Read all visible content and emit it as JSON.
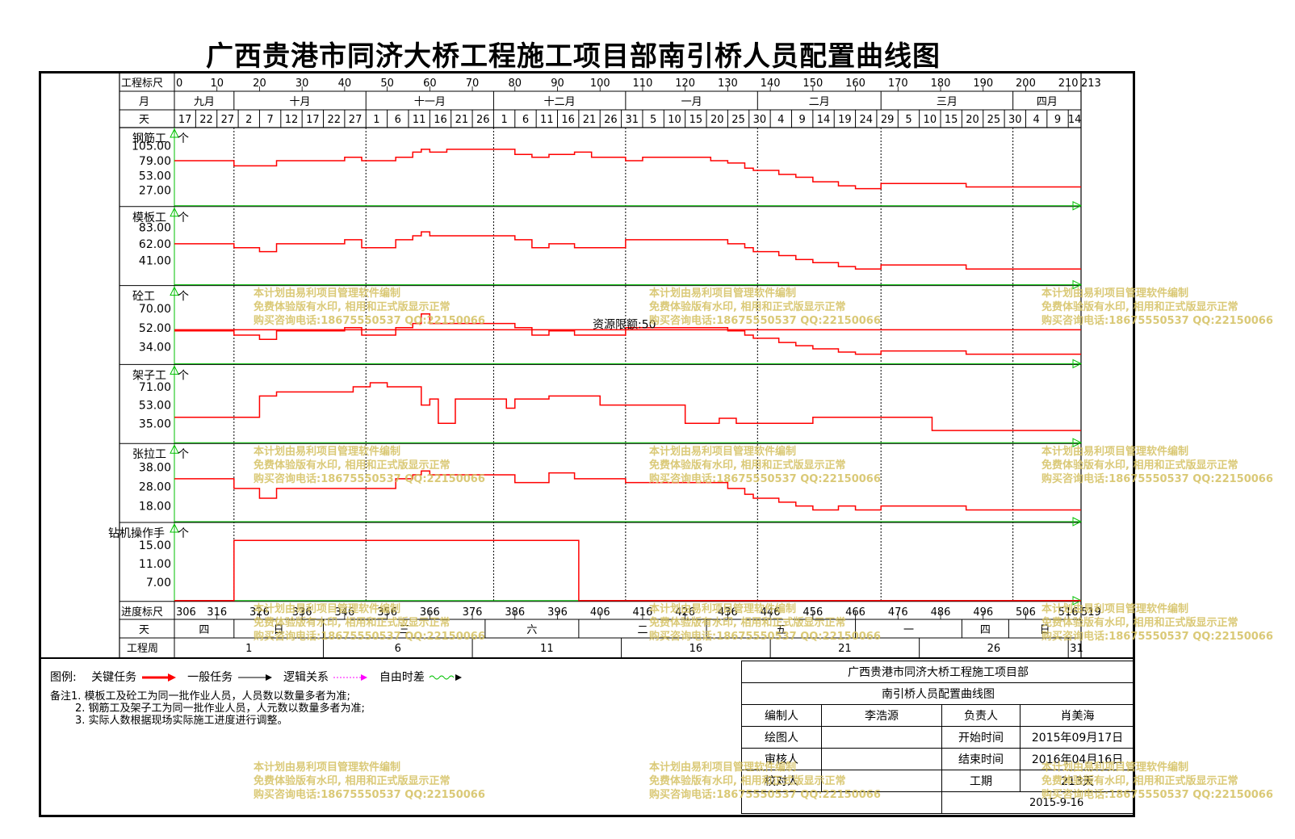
{
  "title": "广西贵港市同济大桥工程施工项目部南引桥人员配置曲线图",
  "header": {
    "row1_label": "工程标尺",
    "row2_label": "月",
    "row3_label": "天",
    "scale_ticks": [
      "0",
      "10",
      "20",
      "30",
      "40",
      "50",
      "60",
      "70",
      "80",
      "90",
      "100",
      "110",
      "120",
      "130",
      "140",
      "150",
      "160",
      "170",
      "180",
      "190",
      "200",
      "210",
      "213"
    ],
    "months": [
      "九月",
      "十月",
      "十一月",
      "十二月",
      "一月",
      "二月",
      "三月",
      "四月"
    ],
    "days": [
      "17",
      "22",
      "27",
      "2",
      "7",
      "12",
      "17",
      "22",
      "27",
      "1",
      "6",
      "11",
      "16",
      "21",
      "26",
      "1",
      "6",
      "11",
      "16",
      "21",
      "26",
      "31",
      "5",
      "10",
      "15",
      "20",
      "25",
      "30",
      "4",
      "9",
      "14",
      "19",
      "24",
      "29",
      "5",
      "10",
      "15",
      "20",
      "25",
      "30",
      "4",
      "9",
      "14"
    ]
  },
  "footer": {
    "row1_label": "进度标尺",
    "row2_label": "天",
    "row3_label": "工程周",
    "progress_ticks": [
      "306",
      "316",
      "326",
      "336",
      "346",
      "356",
      "366",
      "376",
      "386",
      "396",
      "406",
      "416",
      "426",
      "436",
      "446",
      "456",
      "466",
      "476",
      "486",
      "496",
      "506",
      "516",
      "519"
    ],
    "weekdays": [
      "四",
      "日",
      "三",
      "六",
      "二",
      "五",
      "一",
      "四",
      "日"
    ],
    "weeks": [
      "1",
      "6",
      "11",
      "16",
      "21",
      "26",
      "31"
    ]
  },
  "unit_label": "个",
  "quota_label": "资源限额:50",
  "chart_data": {
    "type": "line",
    "step": true,
    "x_unit": "day",
    "x_range": [
      0,
      213
    ],
    "panels": [
      {
        "name": "钢筋工",
        "yticks": [
          "105.00",
          "79.00",
          "53.00",
          "27.00"
        ],
        "ylim": [
          0,
          130
        ],
        "x": [
          0,
          10,
          14,
          20,
          24,
          40,
          44,
          52,
          56,
          58,
          60,
          64,
          80,
          84,
          88,
          94,
          98,
          106,
          110,
          126,
          130,
          134,
          136,
          142,
          146,
          150,
          156,
          160,
          166,
          182,
          186,
          213
        ],
        "y": [
          79,
          79,
          70,
          70,
          79,
          85,
          79,
          85,
          94,
          99,
          94,
          99,
          90,
          85,
          90,
          94,
          85,
          79,
          85,
          79,
          75,
          66,
          62,
          55,
          50,
          42,
          35,
          30,
          39,
          39,
          33,
          33
        ]
      },
      {
        "name": "模板工",
        "yticks": [
          "83.00",
          "62.00",
          "41.00"
        ],
        "ylim": [
          10,
          104
        ],
        "x": [
          0,
          10,
          14,
          20,
          24,
          40,
          44,
          52,
          56,
          58,
          60,
          64,
          80,
          84,
          88,
          94,
          98,
          106,
          110,
          126,
          130,
          134,
          136,
          142,
          146,
          150,
          156,
          160,
          166,
          182,
          186,
          213
        ],
        "y": [
          62,
          62,
          57,
          52,
          62,
          67,
          57,
          67,
          72,
          77,
          72,
          72,
          67,
          57,
          62,
          57,
          57,
          67,
          67,
          67,
          62,
          57,
          52,
          47,
          42,
          38,
          33,
          30,
          35,
          35,
          30,
          30
        ]
      },
      {
        "name": "砼工",
        "yticks": [
          "70.00",
          "52.00",
          "34.00"
        ],
        "ylim": [
          18,
          88
        ],
        "x": [
          0,
          10,
          14,
          20,
          24,
          40,
          44,
          52,
          56,
          58,
          60,
          64,
          80,
          84,
          88,
          94,
          98,
          106,
          110,
          126,
          130,
          134,
          136,
          142,
          146,
          150,
          156,
          160,
          166,
          182,
          186,
          213
        ],
        "y": [
          49,
          49,
          45,
          41,
          49,
          52,
          45,
          52,
          56,
          65,
          56,
          56,
          52,
          45,
          49,
          45,
          45,
          52,
          52,
          52,
          49,
          45,
          42,
          38,
          35,
          32,
          29,
          27,
          30,
          30,
          27,
          27
        ]
      },
      {
        "name": "架子工",
        "yticks": [
          "71.00",
          "53.00",
          "35.00"
        ],
        "ylim": [
          16,
          89
        ],
        "x": [
          0,
          10,
          14,
          20,
          24,
          38,
          42,
          46,
          50,
          56,
          58,
          60,
          62,
          66,
          76,
          78,
          80,
          88,
          100,
          106,
          120,
          128,
          132,
          144,
          150,
          174,
          178,
          213
        ],
        "y": [
          41,
          41,
          41,
          62,
          66,
          66,
          71,
          75,
          71,
          71,
          53,
          59,
          35,
          59,
          59,
          50,
          59,
          62,
          53,
          53,
          35,
          40,
          35,
          35,
          41,
          41,
          28,
          28
        ]
      },
      {
        "name": "张拉工",
        "yticks": [
          "38.00",
          "28.00",
          "18.00"
        ],
        "ylim": [
          10,
          48
        ],
        "x": [
          0,
          10,
          14,
          20,
          24,
          40,
          44,
          52,
          56,
          58,
          60,
          64,
          80,
          84,
          88,
          94,
          98,
          106,
          110,
          126,
          130,
          134,
          136,
          142,
          146,
          150,
          156,
          160,
          166,
          182,
          186,
          213
        ],
        "y": [
          32,
          32,
          27,
          22,
          27,
          27,
          27,
          32,
          34,
          36,
          34,
          34,
          30,
          30,
          35,
          32,
          32,
          30,
          30,
          30,
          27,
          24,
          22,
          20,
          18,
          16,
          18,
          16,
          18,
          18,
          16,
          16
        ]
      },
      {
        "name": "钻机操作手",
        "yticks": [
          "15.00",
          "11.00",
          "7.00"
        ],
        "ylim": [
          3,
          19
        ],
        "x": [
          0,
          14,
          14,
          95,
          95,
          213
        ],
        "y": [
          0,
          0,
          16,
          16,
          0,
          0
        ]
      }
    ]
  },
  "legend": {
    "label": "图例:",
    "items": [
      "关键任务",
      "一般任务",
      "逻辑关系",
      "自由时差"
    ],
    "colors": {
      "key": "#ff0000",
      "general": "#000000",
      "logic": "#ff00ff",
      "float": "#00c000"
    }
  },
  "notes": [
    "备注1. 模板工及砼工为同一批作业人员，人员数以数量多者为准;",
    "2. 钢筋工及架子工为同一批作业人员，人元数以数量多者为准;",
    "3. 实际人数根据现场实际施工进度进行调整。"
  ],
  "title_block": {
    "company": "广西贵港市同济大桥工程施工项目部",
    "drawing": "南引桥人员配置曲线图",
    "compiler_label": "编制人",
    "compiler": "李浩源",
    "owner_label": "负责人",
    "owner": "肖美海",
    "drafter_label": "绘图人",
    "drafter": "",
    "start_label": "开始时间",
    "start": "2015年09月17日",
    "reviewer_label": "审核人",
    "reviewer": "",
    "end_label": "结束时间",
    "end": "2016年04月16日",
    "checker_label": "校对人",
    "checker": "",
    "duration_label": "工期",
    "duration": "213天",
    "date": "2015-9-16"
  },
  "watermark": {
    "line1": "本计划由易利项目管理软件编制",
    "line2": "免费体验版有水印, 相用和正式版显示正常",
    "line3": "购买咨询电话:18675550537 QQ:22150066"
  },
  "colors": {
    "series": "#ff0000",
    "baseline": "#00c000",
    "grid": "#000000",
    "watermark": "#d4c060"
  }
}
